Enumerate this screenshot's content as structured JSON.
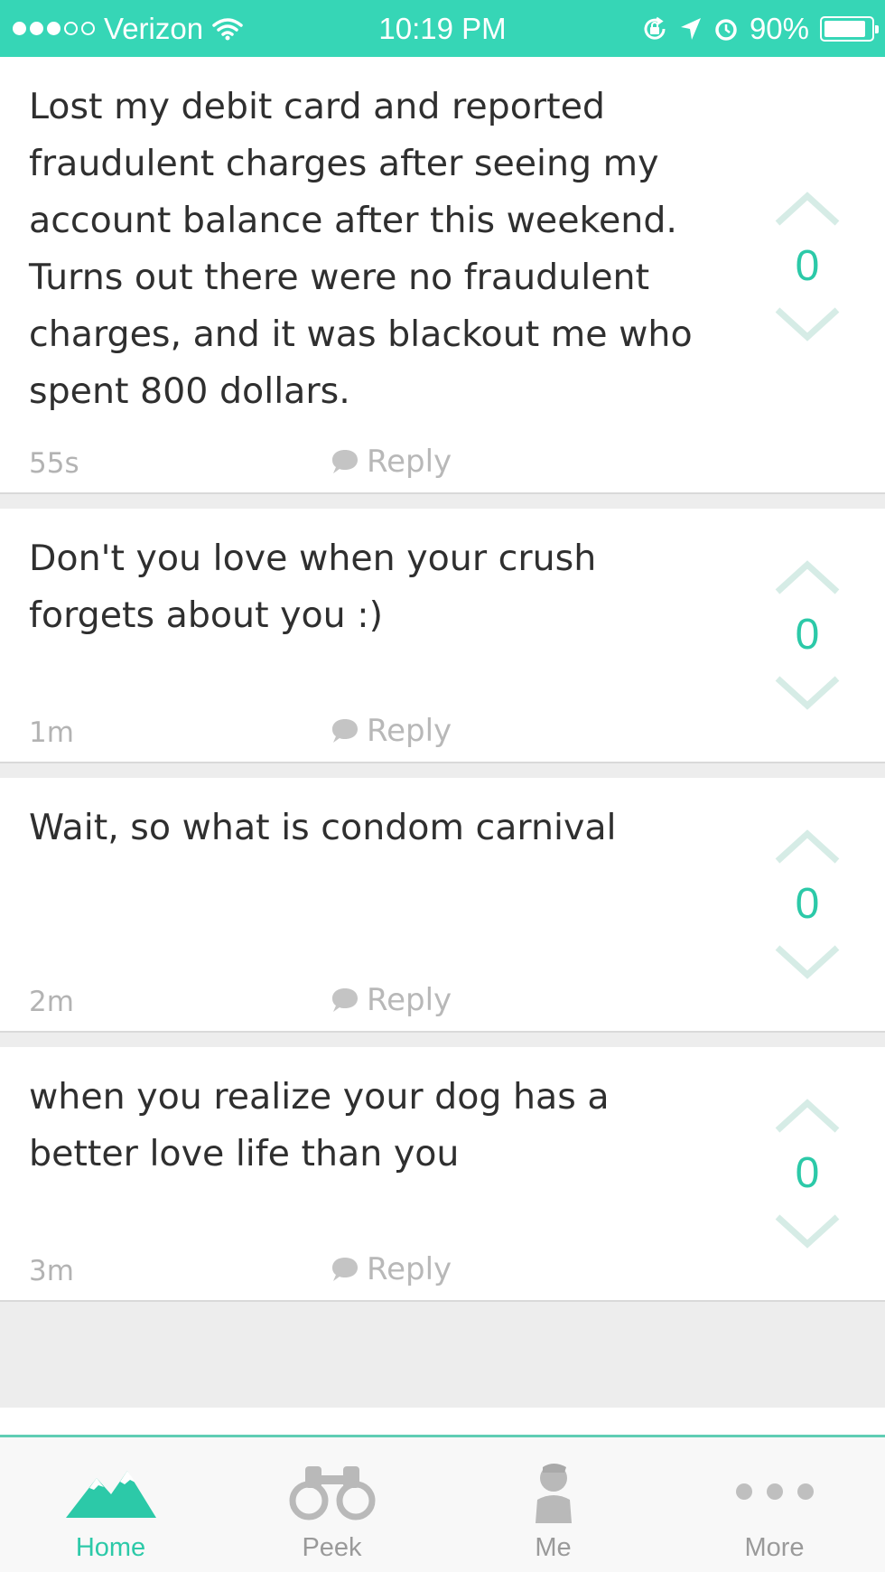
{
  "status_bar": {
    "carrier": "Verizon",
    "time": "10:19 PM",
    "battery": "90%",
    "battery_level": 0.9,
    "signal_bars_filled": 3,
    "signal_bars_total": 5,
    "icons": [
      "wifi-icon",
      "rotation-lock-icon",
      "location-arrow-icon",
      "alarm-icon",
      "battery-icon"
    ]
  },
  "posts": [
    {
      "text": "Lost my debit card and reported fraudulent charges after seeing my account balance after this weekend. Turns out there were no fraudulent charges, and it was blackout me who spent 800 dollars.",
      "time": "55s",
      "reply_label": "Reply",
      "votes": "0"
    },
    {
      "text": "Don't you love when your crush forgets about you :)",
      "time": "1m",
      "reply_label": "Reply",
      "votes": "0"
    },
    {
      "text": "Wait, so what is condom carnival",
      "time": "2m",
      "reply_label": "Reply",
      "votes": "0"
    },
    {
      "text": "when you realize your dog has a better love life than you",
      "time": "3m",
      "reply_label": "Reply",
      "votes": "0"
    }
  ],
  "tabs": [
    {
      "label": "Home",
      "icon": "mountain-icon",
      "active": true
    },
    {
      "label": "Peek",
      "icon": "binoculars-icon",
      "active": false
    },
    {
      "label": "Me",
      "icon": "person-icon",
      "active": false
    },
    {
      "label": "More",
      "icon": "more-dots-icon",
      "active": false
    }
  ],
  "colors": {
    "accent": "#36d6b6",
    "vote_count": "#2cc9a8",
    "vote_arrow": "#d6ece6",
    "muted_text": "#b3b3b3"
  }
}
